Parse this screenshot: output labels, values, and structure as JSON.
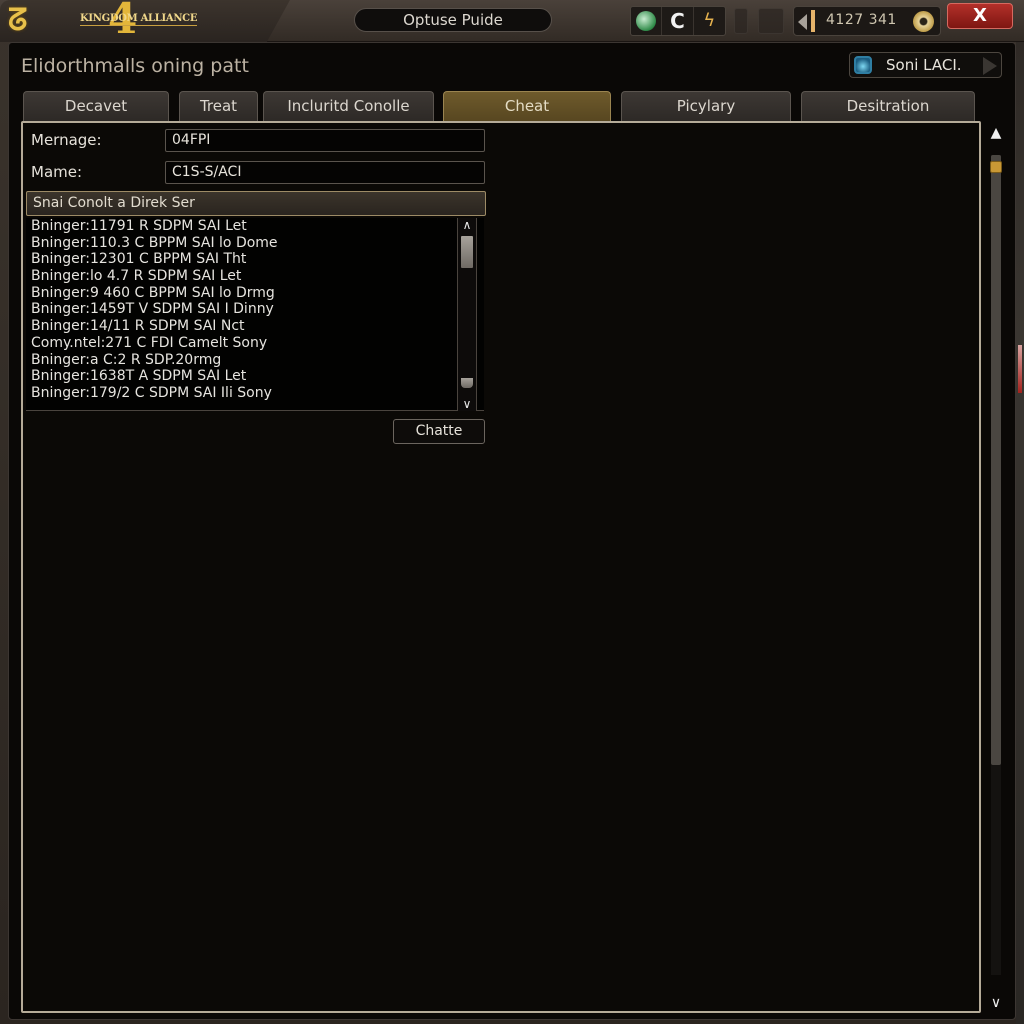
{
  "titlebar": {
    "logo_text": "KINGDOM ALLIANCE",
    "logo_number": "4",
    "window_title": "Optuse Puide",
    "tools": [
      {
        "icon": "green-orb-icon"
      },
      {
        "icon": "refresh-icon",
        "glyph": "C"
      },
      {
        "icon": "lightning-icon",
        "glyph": "ϟ"
      }
    ],
    "currency_amount": "4127 341",
    "close_label": "X"
  },
  "window": {
    "heading": "Elidorthmalls oning patt",
    "profile_label": "Soni LACI."
  },
  "tabs": [
    {
      "label": "Decavet",
      "active": false
    },
    {
      "label": "Treat",
      "active": false
    },
    {
      "label": "Incluritd Conolle",
      "active": false
    },
    {
      "label": "Cheat",
      "active": true
    },
    {
      "label": "Picylary",
      "active": false
    },
    {
      "label": "Desitration",
      "active": false
    }
  ],
  "form": {
    "message_label": "Mernage:",
    "message_value": "04FPI",
    "name_label": "Mame:",
    "name_value": "C1S-S/ACI"
  },
  "section": {
    "header": "Snai Conolt a Direk Ser",
    "rows": [
      "Bninger:11791 R SDPM SAI Let",
      "Bninger:110.3 C BPPM SAI lo Dome",
      "Bninger:12301 C BPPM SAI Tht",
      "Bninger:lo 4.7 R SDPM SAI Let",
      "Bninger:9 460 C BPPM SAI lo Drmg",
      "Bninger:1459T V SDPM SAI I Dinny",
      "Bninger:14/11 R SDPM SAI Nct",
      "Comy.ntel:271 C FDI Camelt Sony",
      "Bninger:a C:2 R SDP.20rmg",
      "Bninger:1638T A SDPM SAI Let",
      "Bninger:179/2 C SDPM SAI Ili Sony"
    ],
    "action_label": "Chatte"
  },
  "scrollbar": {
    "up": "▲",
    "down": "∨",
    "list_up": "∧",
    "list_down": "∨"
  }
}
